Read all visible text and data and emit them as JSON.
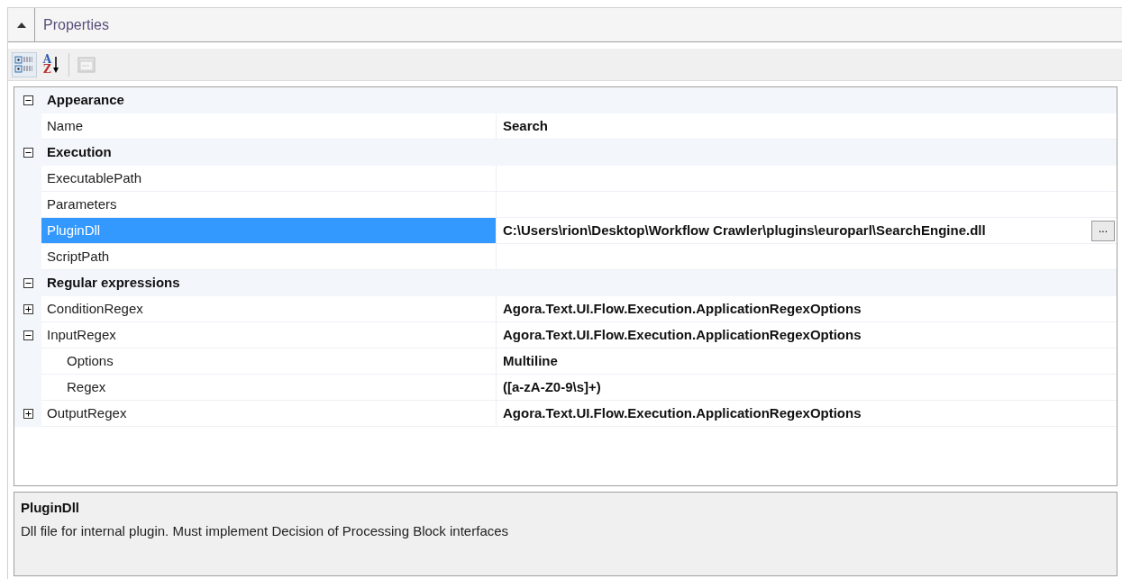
{
  "panel": {
    "title": "Properties",
    "collapsed": false
  },
  "toolbar": [
    {
      "kind": "categorized",
      "selected": true
    },
    {
      "kind": "alphabetical",
      "selected": false,
      "letters": [
        "A",
        "Z"
      ]
    },
    {
      "kind": "property-pages",
      "disabled": true
    }
  ],
  "grid": [
    {
      "name": "Appearance",
      "expanded": true,
      "properties": [
        {
          "name": "Name",
          "value": "Search",
          "selected": false
        }
      ]
    },
    {
      "name": "Execution",
      "expanded": true,
      "properties": [
        {
          "name": "ExecutablePath",
          "selected": false
        },
        {
          "name": "Parameters",
          "selected": false
        },
        {
          "name": "PluginDll",
          "value": "C:\\Users\\rion\\Desktop\\Workflow Crawler\\plugins\\europarl\\SearchEngine.dll",
          "selected": true,
          "button": "..."
        },
        {
          "name": "ScriptPath",
          "selected": false
        }
      ]
    },
    {
      "name": "Regular expressions",
      "expanded": true,
      "properties": [
        {
          "name": "ConditionRegex",
          "value": "Agora.Text.UI.Flow.Execution.ApplicationRegexOptions",
          "selected": false,
          "expanded": false
        },
        {
          "name": "InputRegex",
          "value": "Agora.Text.UI.Flow.Execution.ApplicationRegexOptions",
          "selected": false,
          "expanded": true,
          "children": [
            {
              "name": "Options",
              "value": "Multiline",
              "selected": false
            },
            {
              "name": "Regex",
              "value": "([a-zA-Z0-9\\s]+)",
              "selected": false
            }
          ]
        },
        {
          "name": "OutputRegex",
          "value": "Agora.Text.UI.Flow.Execution.ApplicationRegexOptions",
          "selected": false,
          "expanded": false
        }
      ]
    }
  ],
  "description": {
    "title": "PluginDll",
    "text": "Dll file for internal plugin. Must implement Decision of Processing Block interfaces"
  }
}
